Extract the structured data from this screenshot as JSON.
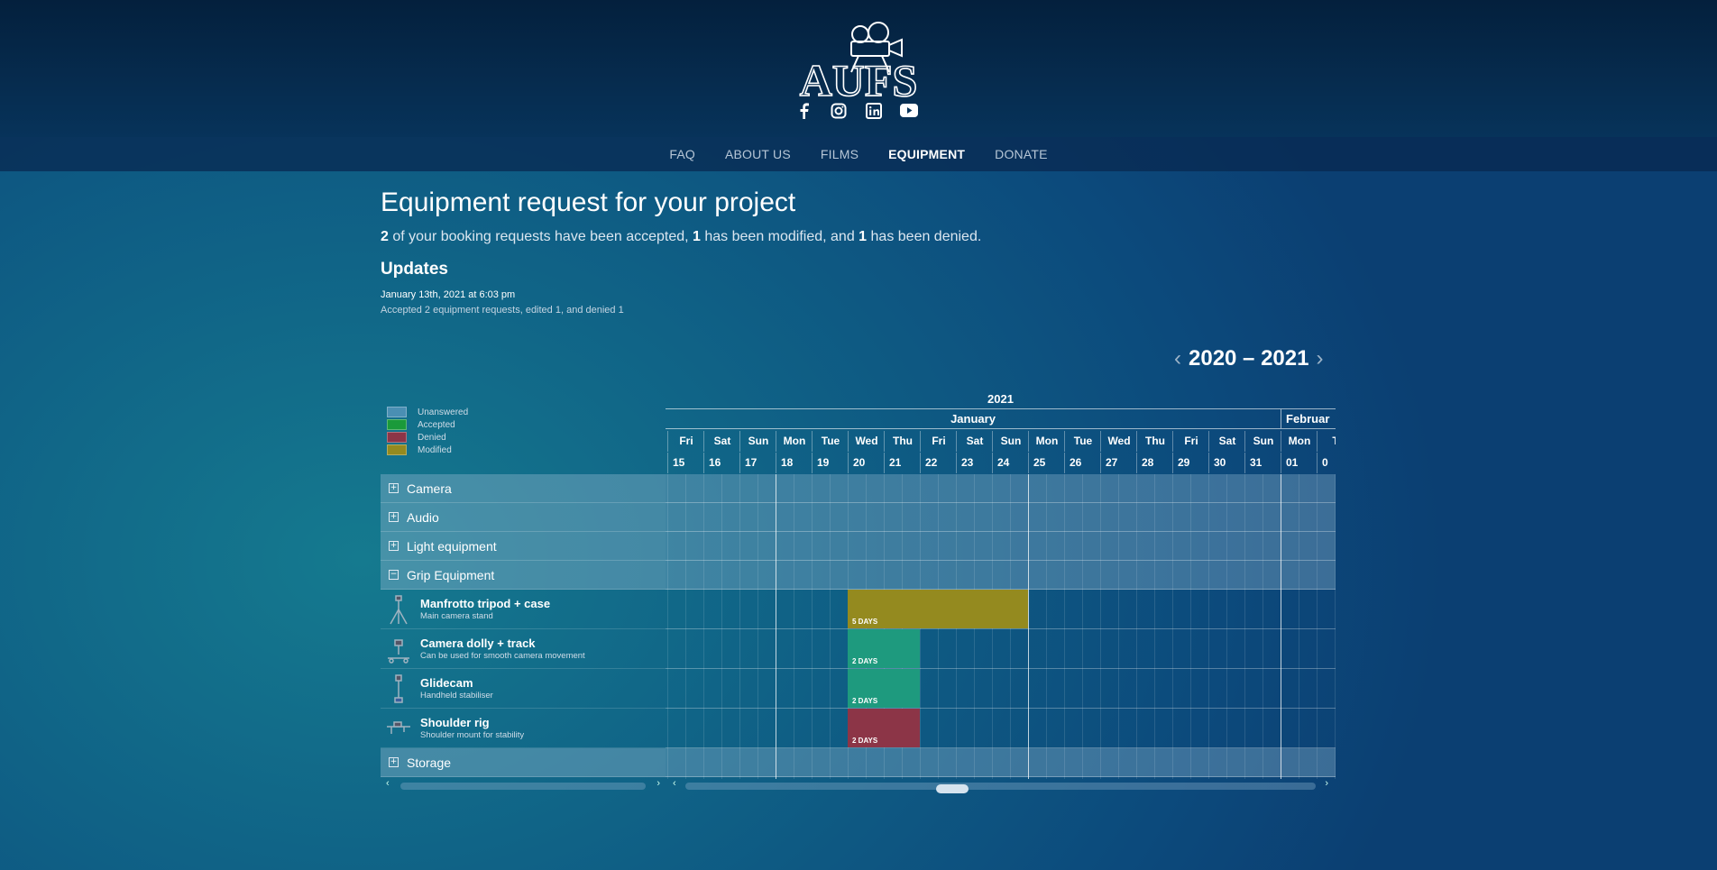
{
  "brand": {
    "logo_text": "AUFS"
  },
  "socials": [
    "facebook-icon",
    "instagram-icon",
    "linkedin-icon",
    "youtube-icon"
  ],
  "nav": [
    {
      "label": "FAQ",
      "active": false
    },
    {
      "label": "ABOUT US",
      "active": false
    },
    {
      "label": "FILMS",
      "active": false
    },
    {
      "label": "EQUIPMENT",
      "active": true
    },
    {
      "label": "DONATE",
      "active": false
    }
  ],
  "header": {
    "title": "Equipment request for your project",
    "summary": {
      "accepted_count": "2",
      "accepted_text": " of your booking requests have been accepted, ",
      "modified_count": "1",
      "modified_text": " has been modified, and ",
      "denied_count": "1",
      "denied_text": " has been denied."
    }
  },
  "updates": {
    "title": "Updates",
    "date": "January 13th, 2021 at 6:03 pm",
    "text": "Accepted 2 equipment requests, edited 1, and denied 1"
  },
  "year_nav": {
    "label": "2020 – 2021",
    "prev": "‹",
    "next": "›"
  },
  "legend": [
    {
      "label": "Unanswered",
      "color": "#4a8fb3"
    },
    {
      "label": "Accepted",
      "color": "#1a9a3a"
    },
    {
      "label": "Denied",
      "color": "#8c3547"
    },
    {
      "label": "Modified",
      "color": "#948a1f"
    }
  ],
  "sidebar": [
    {
      "type": "category",
      "name": "Camera",
      "expanded": false,
      "toggle": "+"
    },
    {
      "type": "category",
      "name": "Audio",
      "expanded": false,
      "toggle": "+"
    },
    {
      "type": "category",
      "name": "Light equipment",
      "expanded": false,
      "toggle": "+"
    },
    {
      "type": "category",
      "name": "Grip Equipment",
      "expanded": true,
      "toggle": "−"
    },
    {
      "type": "item",
      "name": "Manfrotto tripod + case",
      "desc": "Main camera stand",
      "icon": "tripod-icon"
    },
    {
      "type": "item",
      "name": "Camera dolly + track",
      "desc": "Can be used for smooth camera movement",
      "icon": "dolly-icon"
    },
    {
      "type": "item",
      "name": "Glidecam",
      "desc": "Handheld stabiliser",
      "icon": "glidecam-icon"
    },
    {
      "type": "item",
      "name": "Shoulder rig",
      "desc": "Shoulder mount for stability",
      "icon": "shoulder-rig-icon"
    },
    {
      "type": "category",
      "name": "Storage",
      "expanded": false,
      "toggle": "+"
    }
  ],
  "timeline": {
    "year": "2021",
    "months": [
      {
        "label": "January",
        "day_count": 17
      },
      {
        "label": "Februar",
        "day_count": 2
      }
    ],
    "days": [
      {
        "dow": "Fri",
        "date": "15"
      },
      {
        "dow": "Sat",
        "date": "16"
      },
      {
        "dow": "Sun",
        "date": "17"
      },
      {
        "dow": "Mon",
        "date": "18"
      },
      {
        "dow": "Tue",
        "date": "19"
      },
      {
        "dow": "Wed",
        "date": "20"
      },
      {
        "dow": "Thu",
        "date": "21"
      },
      {
        "dow": "Fri",
        "date": "22"
      },
      {
        "dow": "Sat",
        "date": "23"
      },
      {
        "dow": "Sun",
        "date": "24"
      },
      {
        "dow": "Mon",
        "date": "25"
      },
      {
        "dow": "Tue",
        "date": "26"
      },
      {
        "dow": "Wed",
        "date": "27"
      },
      {
        "dow": "Thu",
        "date": "28"
      },
      {
        "dow": "Fri",
        "date": "29"
      },
      {
        "dow": "Sat",
        "date": "30"
      },
      {
        "dow": "Sun",
        "date": "31"
      },
      {
        "dow": "Mon",
        "date": "01"
      },
      {
        "dow": "T",
        "date": "0"
      }
    ],
    "bookings": [
      {
        "item": "Manfrotto tripod + case",
        "start": "2021-01-20",
        "days": 5,
        "label": "5 DAYS",
        "status": "Modified",
        "color": "#948a1f"
      },
      {
        "item": "Camera dolly + track",
        "start": "2021-01-20",
        "days": 2,
        "label": "2 DAYS",
        "status": "Accepted",
        "color": "#1e9a7e"
      },
      {
        "item": "Glidecam",
        "start": "2021-01-20",
        "days": 2,
        "label": "2 DAYS",
        "status": "Accepted",
        "color": "#1e9a7e"
      },
      {
        "item": "Shoulder rig",
        "start": "2021-01-20",
        "days": 2,
        "label": "2 DAYS",
        "status": "Denied",
        "color": "#8c3547"
      }
    ]
  },
  "scroll": {
    "left": "‹",
    "right": "›"
  }
}
